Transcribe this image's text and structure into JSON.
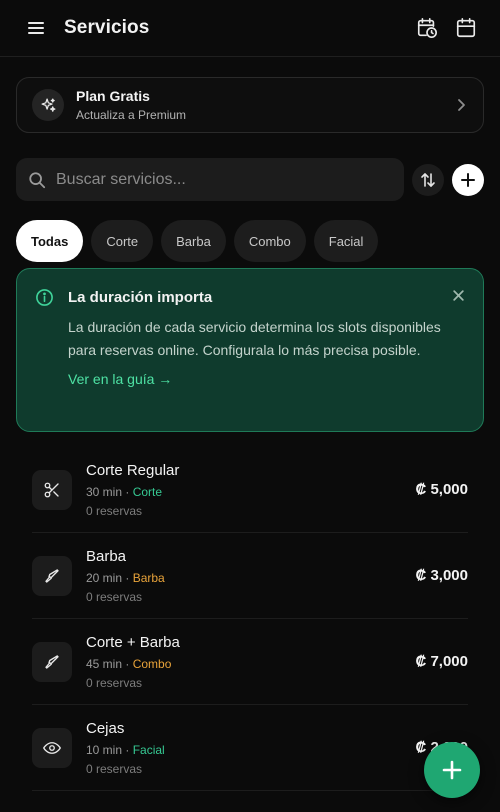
{
  "header": {
    "title": "Servicios",
    "menu_icon": "menu-icon",
    "actions": [
      {
        "icon": "calendar-clock-icon"
      },
      {
        "icon": "calendar-icon"
      }
    ]
  },
  "plan": {
    "icon": "sparkles-icon",
    "title": "Plan Gratis",
    "subtitle": "Actualiza a Premium"
  },
  "search": {
    "placeholder": "Buscar servicios...",
    "value": ""
  },
  "filters": [
    {
      "label": "Todas",
      "active": true
    },
    {
      "label": "Corte",
      "active": false
    },
    {
      "label": "Barba",
      "active": false
    },
    {
      "label": "Combo",
      "active": false
    },
    {
      "label": "Facial",
      "active": false
    }
  ],
  "info": {
    "title": "La duración importa",
    "body": "La duración de cada servicio determina los slots disponibles para reservas online. Configurala lo más precisa posible.",
    "link": "Ver en la guía →"
  },
  "services": [
    {
      "icon": "scissors-icon",
      "name": "Corte Regular",
      "duration": "30 min",
      "category": "Corte",
      "category_color": "#36c993",
      "reservations": "0 reservas",
      "price": "₡ 5,000"
    },
    {
      "icon": "razor-icon",
      "name": "Barba",
      "duration": "20 min",
      "category": "Barba",
      "category_color": "#e8a33a",
      "reservations": "0 reservas",
      "price": "₡ 3,000"
    },
    {
      "icon": "razor-icon",
      "name": "Corte + Barba",
      "duration": "45 min",
      "category": "Combo",
      "category_color": "#e8a33a",
      "reservations": "0 reservas",
      "price": "₡ 7,000"
    },
    {
      "icon": "eye-icon",
      "name": "Cejas",
      "duration": "10 min",
      "category": "Facial",
      "category_color": "#36c993",
      "reservations": "0 reservas",
      "price": "₡ 2,000"
    }
  ],
  "meta_separator": " · ",
  "colors": {
    "accent": "#1fa772",
    "info_bg": "#0f3b2d",
    "info_border": "#1f7a58",
    "link": "#4ee2a4"
  },
  "fab": {
    "icon": "plus-icon"
  }
}
